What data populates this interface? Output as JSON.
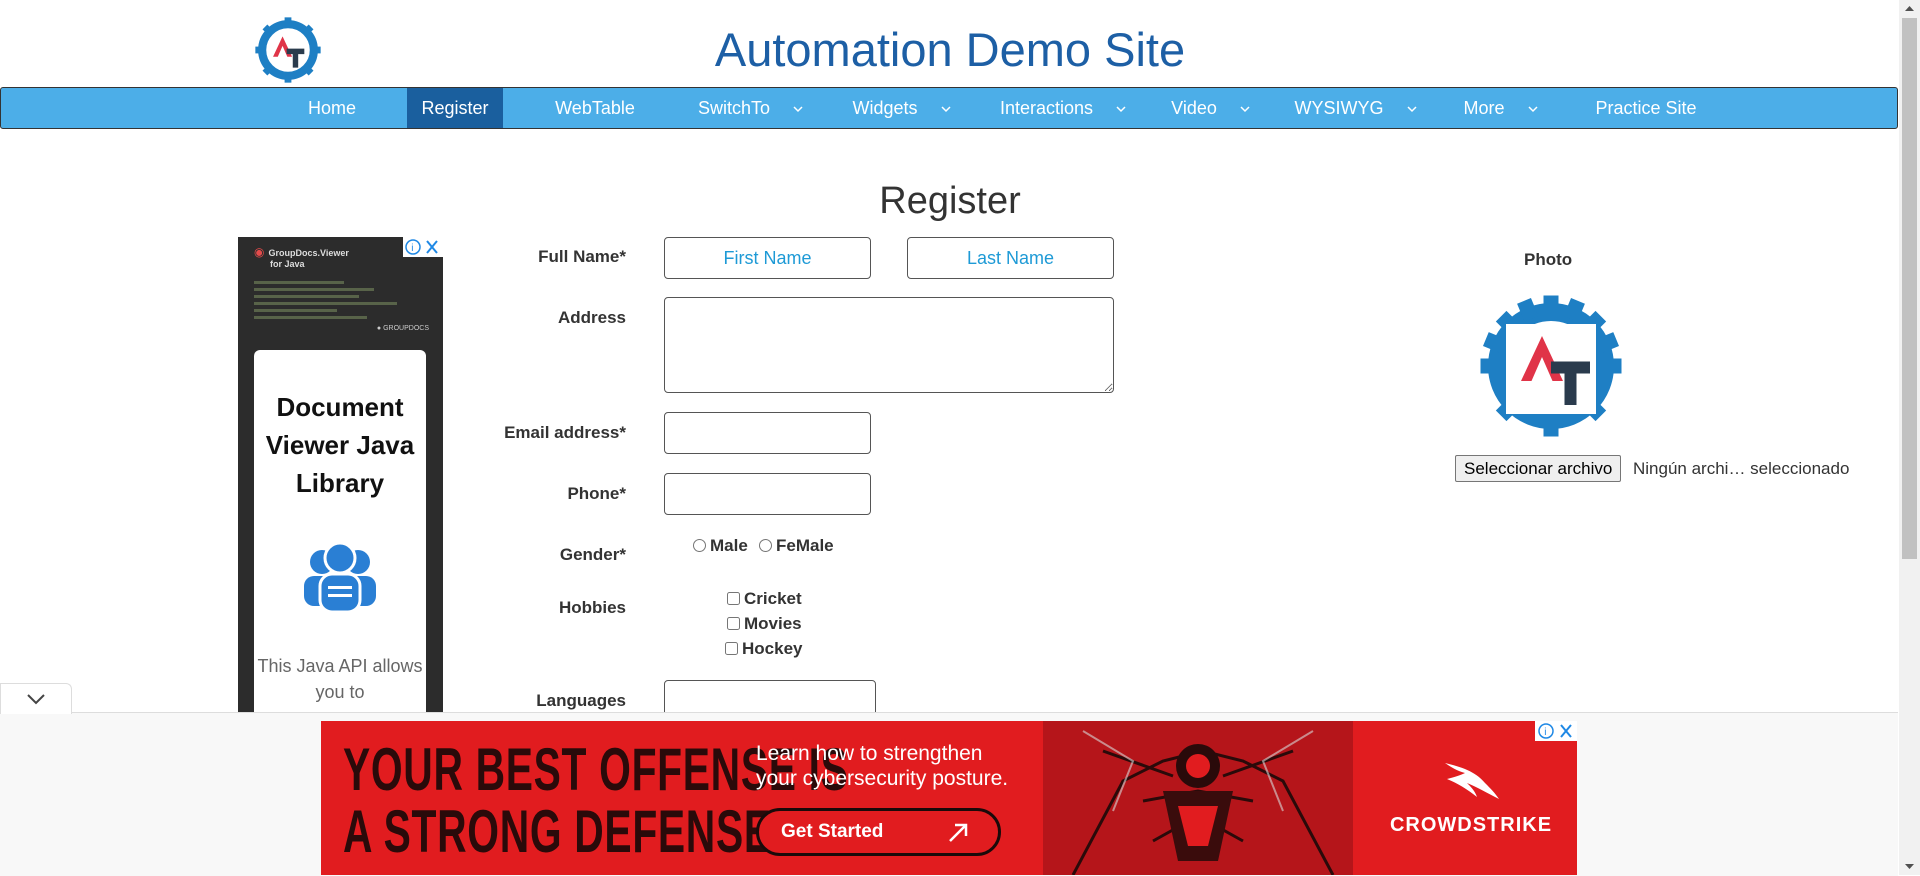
{
  "header": {
    "title": "Automation Demo Site"
  },
  "nav": {
    "items": [
      {
        "label": "Home"
      },
      {
        "label": "Register"
      },
      {
        "label": "WebTable"
      },
      {
        "label": "SwitchTo"
      },
      {
        "label": "Widgets"
      },
      {
        "label": "Interactions"
      },
      {
        "label": "Video"
      },
      {
        "label": "WYSIWYG"
      },
      {
        "label": "More"
      },
      {
        "label": "Practice Site"
      }
    ],
    "active": "Register",
    "background": "#4caee8",
    "active_background": "#1a5f9e"
  },
  "page": {
    "heading": "Register"
  },
  "side_ad": {
    "brand_line1": "GroupDocs.Viewer",
    "brand_line2": "for Java",
    "card_title": "Document Viewer Java Library",
    "card_text": "This Java API allows you to"
  },
  "form": {
    "full_name_label": "Full Name*",
    "first_name_placeholder": "First Name",
    "last_name_placeholder": "Last Name",
    "address_label": "Address",
    "email_label": "Email address*",
    "phone_label": "Phone*",
    "gender_label": "Gender*",
    "gender_options": [
      "Male",
      "FeMale"
    ],
    "hobbies_label": "Hobbies",
    "hobbies": [
      "Cricket",
      "Movies",
      "Hockey"
    ],
    "languages_label": "Languages"
  },
  "photo": {
    "label": "Photo",
    "file_button": "Seleccionar archivo",
    "file_status": "Ningún archi… seleccionado"
  },
  "banner_ad": {
    "headline_line1": "YOUR BEST OFFENSE IS",
    "headline_line2": "A STRONG DEFENSE.",
    "subtext_line1": "Learn how to strengthen",
    "subtext_line2": "your cybersecurity posture.",
    "cta": "Get Started",
    "brand": "CROWDSTRIKE",
    "color": "#e11c1f"
  }
}
